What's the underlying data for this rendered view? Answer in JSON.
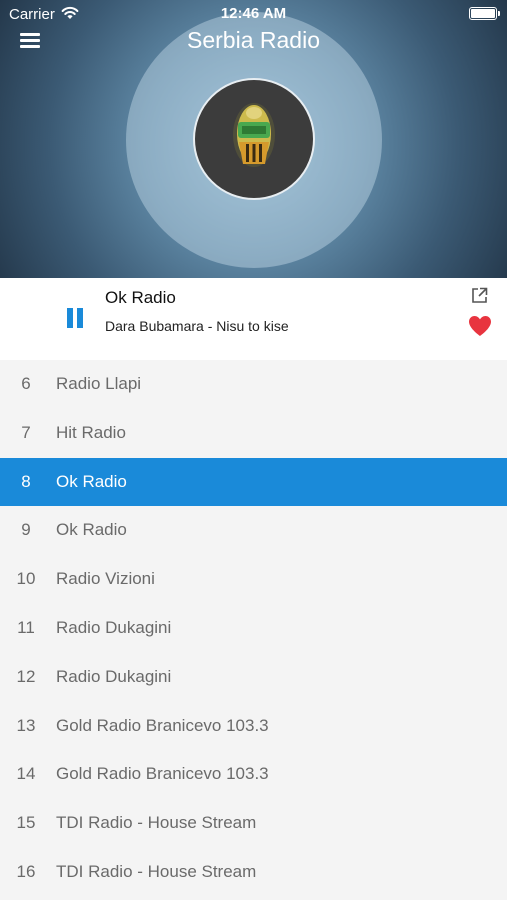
{
  "status_bar": {
    "carrier": "Carrier",
    "time": "12:46 AM",
    "wifi_icon": "wifi-icon",
    "battery_icon": "battery-icon"
  },
  "header": {
    "title": "Serbia Radio",
    "menu_icon": "hamburger-menu-icon"
  },
  "now_playing": {
    "station": "Ok Radio",
    "track": "Dara Bubamara - Nisu to kise",
    "state": "playing",
    "controls": [
      "pause-icon",
      "share-icon",
      "heart-icon"
    ],
    "favorite": true
  },
  "stations": [
    {
      "num": "6",
      "name": "Radio Llapi",
      "active": false
    },
    {
      "num": "7",
      "name": "Hit Radio",
      "active": false
    },
    {
      "num": "8",
      "name": "Ok Radio",
      "active": true
    },
    {
      "num": "9",
      "name": "Ok Radio",
      "active": false
    },
    {
      "num": "10",
      "name": "Radio Vizioni",
      "active": false
    },
    {
      "num": "11",
      "name": "Radio Dukagini",
      "active": false
    },
    {
      "num": "12",
      "name": "Radio Dukagini",
      "active": false
    },
    {
      "num": "13",
      "name": "Gold Radio Branicevo 103.3",
      "active": false
    },
    {
      "num": "14",
      "name": "Gold Radio Branicevo 103.3",
      "active": false
    },
    {
      "num": "15",
      "name": "TDI Radio - House Stream",
      "active": false
    },
    {
      "num": "16",
      "name": "TDI Radio - House Stream",
      "active": false
    }
  ],
  "colors": {
    "accent": "#1a8ad9",
    "heart": "#e8343f",
    "list_background": "#f4f4f4",
    "list_text": "#6a6a6a"
  }
}
